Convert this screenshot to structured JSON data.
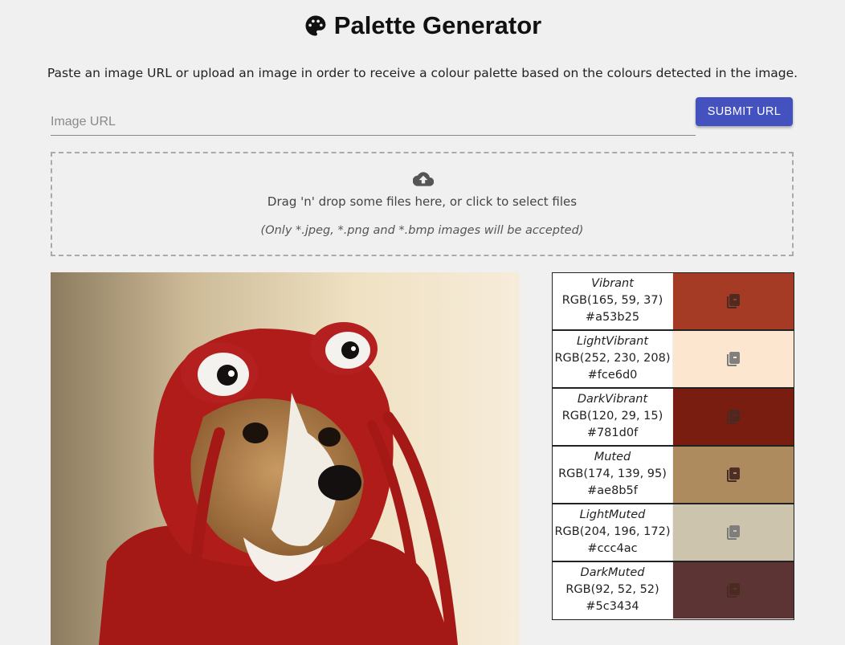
{
  "header": {
    "title": "Palette Generator",
    "subtitle": "Paste an image URL or upload an image in order to receive a colour palette based on the colours detected in the image."
  },
  "url_form": {
    "placeholder": "Image URL",
    "value": "",
    "submit_label": "SUBMIT URL",
    "accent": "#4452c0"
  },
  "dropzone": {
    "text": "Drag 'n' drop some files here, or click to select files",
    "hint": "(Only *.jpeg, *.png and *.bmp images will be accepted)",
    "icon": "cloud-upload-icon"
  },
  "palette": [
    {
      "name": "Vibrant",
      "rgb": "RGB(165, 59, 37)",
      "hex": "#a53b25",
      "color": "#a53b25"
    },
    {
      "name": "LightVibrant",
      "rgb": "RGB(252, 230, 208)",
      "hex": "#fce6d0",
      "color": "#fce6d0"
    },
    {
      "name": "DarkVibrant",
      "rgb": "RGB(120, 29, 15)",
      "hex": "#781d0f",
      "color": "#781d0f"
    },
    {
      "name": "Muted",
      "rgb": "RGB(174, 139, 95)",
      "hex": "#ae8b5f",
      "color": "#ae8b5f"
    },
    {
      "name": "LightMuted",
      "rgb": "RGB(204, 196, 172)",
      "hex": "#ccc4ac",
      "color": "#ccc4ac"
    },
    {
      "name": "DarkMuted",
      "rgb": "RGB(92, 52, 52)",
      "hex": "#5c3434",
      "color": "#5c3434"
    }
  ]
}
